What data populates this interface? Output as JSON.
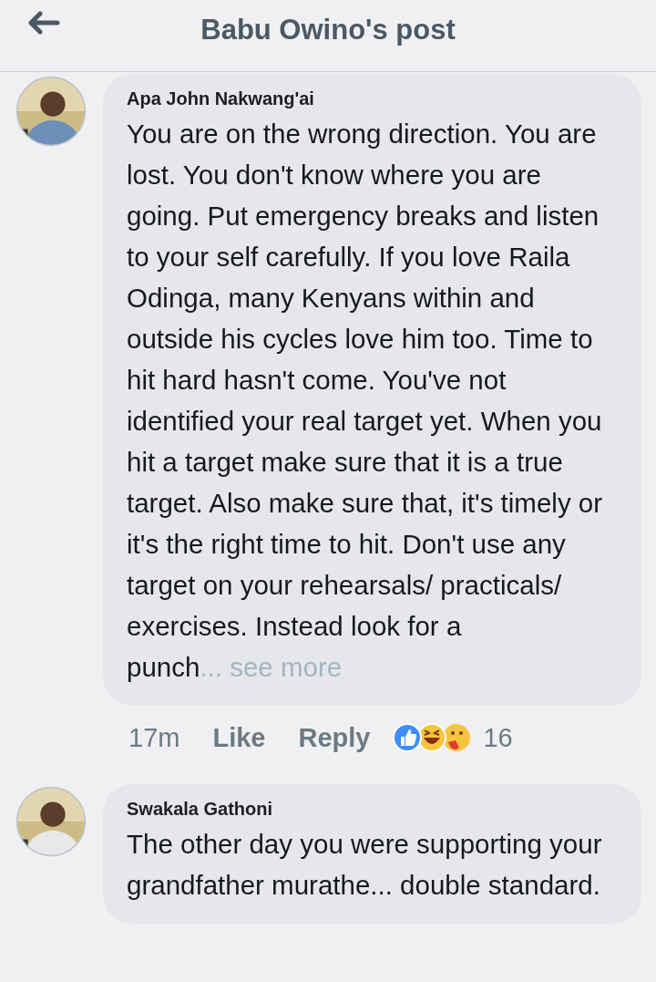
{
  "header": {
    "title": "Babu Owino's post"
  },
  "comments": [
    {
      "author": "Apa John Nakwang'ai",
      "text": "You are on the wrong direction. You are lost. You don't know where you are going. Put emergency breaks and listen to your self carefully. If you love Raila Odinga, many Kenyans within and outside his cycles love him too. Time to hit hard hasn't come. You've not identified your real target yet. When you hit a target make sure that it is a true target. Also make sure that, it's timely or it's the right time to hit. Don't use any target on your rehearsals/ practicals/ exercises. Instead look for a punch",
      "see_more": "... see more",
      "time": "17m",
      "like": "Like",
      "reply": "Reply",
      "reaction_count": "16"
    },
    {
      "author": "Swakala Gathoni",
      "text": "The other day you were supporting your grandfather murathe... double standard."
    }
  ]
}
